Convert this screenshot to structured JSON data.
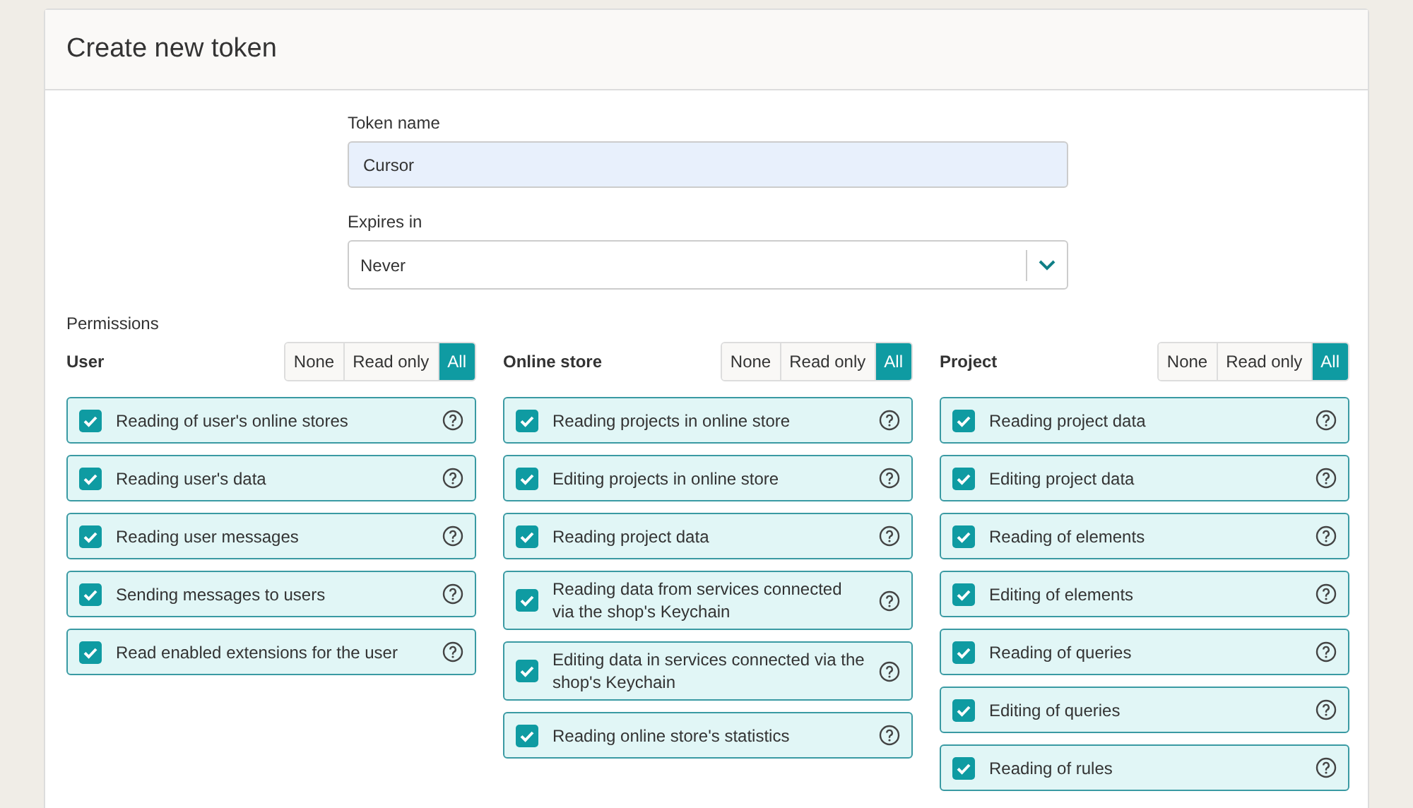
{
  "title": "Create new token",
  "token_name": {
    "label": "Token name",
    "value": "Cursor"
  },
  "expires": {
    "label": "Expires in",
    "value": "Never"
  },
  "permissions_label": "Permissions",
  "groups": [
    {
      "name": "User",
      "levels": [
        {
          "label": "None",
          "selected": false
        },
        {
          "label": "Read only",
          "selected": false
        },
        {
          "label": "All",
          "selected": true
        }
      ],
      "items": [
        {
          "label": "Reading of user's online stores",
          "checked": true
        },
        {
          "label": "Reading user's data",
          "checked": true
        },
        {
          "label": "Reading user messages",
          "checked": true
        },
        {
          "label": "Sending messages to users",
          "checked": true
        },
        {
          "label": "Read enabled extensions for the user",
          "checked": true
        }
      ]
    },
    {
      "name": "Online store",
      "levels": [
        {
          "label": "None",
          "selected": false
        },
        {
          "label": "Read only",
          "selected": false
        },
        {
          "label": "All",
          "selected": true
        }
      ],
      "items": [
        {
          "label": "Reading projects in online store",
          "checked": true
        },
        {
          "label": "Editing projects in online store",
          "checked": true
        },
        {
          "label": "Reading project data",
          "checked": true
        },
        {
          "label": "Reading data from services connected via the shop's Keychain",
          "checked": true
        },
        {
          "label": "Editing data in services connected via the shop's Keychain",
          "checked": true
        },
        {
          "label": "Reading online store's statistics",
          "checked": true
        }
      ]
    },
    {
      "name": "Project",
      "levels": [
        {
          "label": "None",
          "selected": false
        },
        {
          "label": "Read only",
          "selected": false
        },
        {
          "label": "All",
          "selected": true
        }
      ],
      "items": [
        {
          "label": "Reading project data",
          "checked": true
        },
        {
          "label": "Editing project data",
          "checked": true
        },
        {
          "label": "Reading of elements",
          "checked": true
        },
        {
          "label": "Editing of elements",
          "checked": true
        },
        {
          "label": "Reading of queries",
          "checked": true
        },
        {
          "label": "Editing of queries",
          "checked": true
        },
        {
          "label": "Reading of rules",
          "checked": true
        }
      ]
    }
  ]
}
